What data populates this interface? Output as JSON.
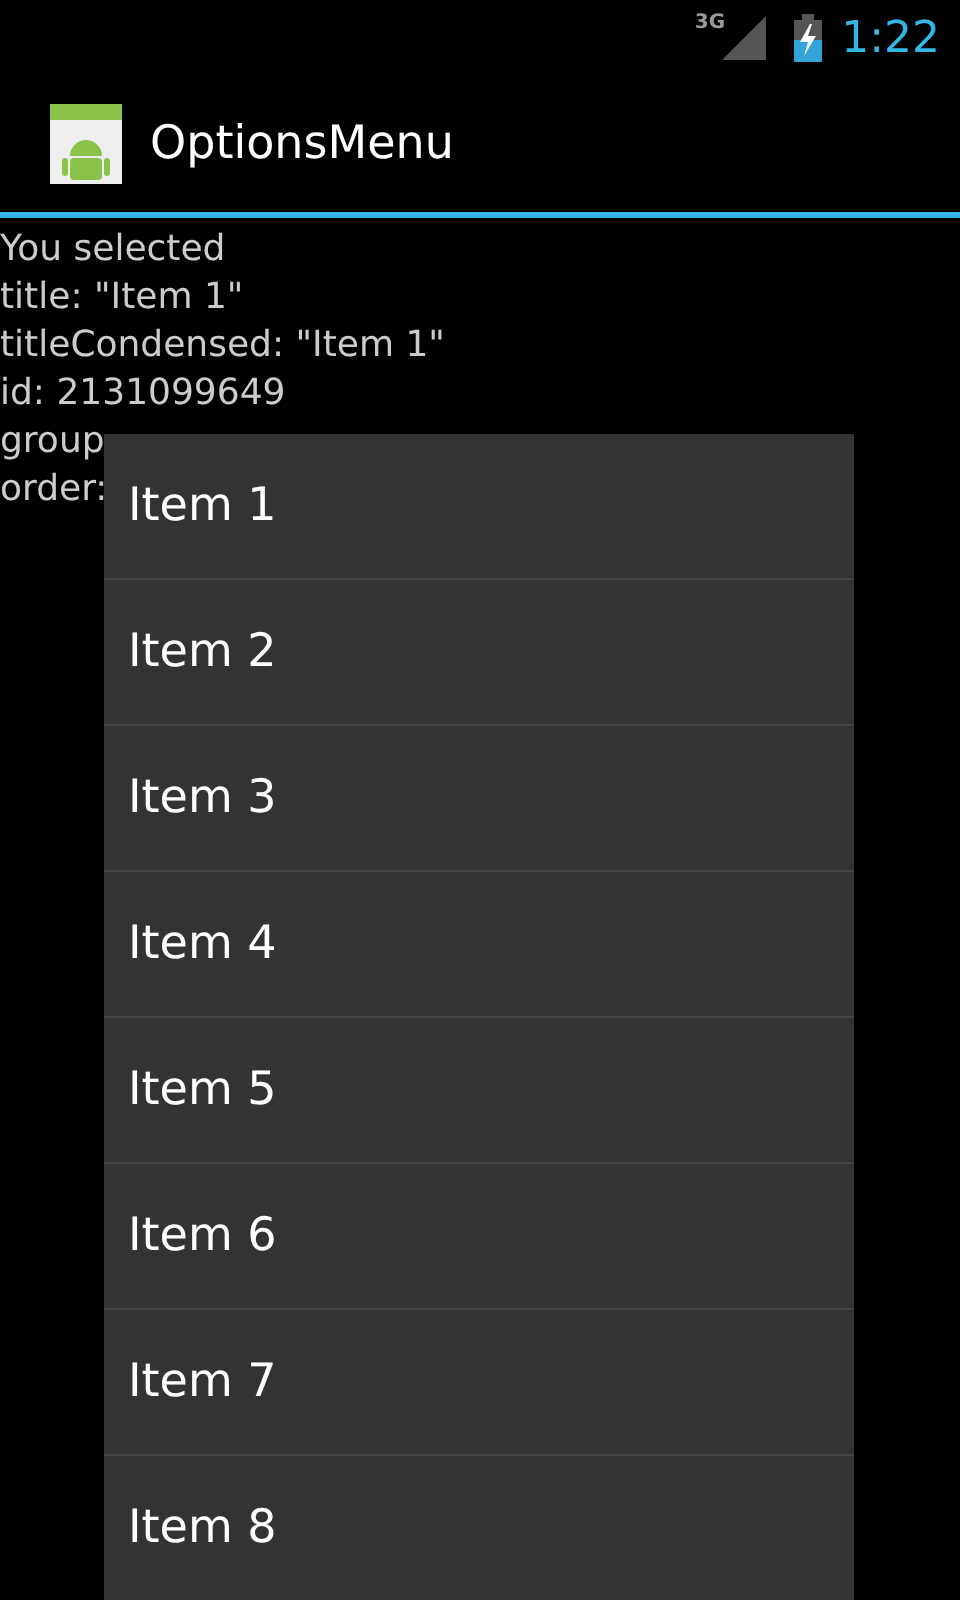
{
  "status_bar": {
    "network": "3G",
    "time": "1:22"
  },
  "action_bar": {
    "title": "OptionsMenu"
  },
  "content": {
    "lines": [
      "You selected",
      "title: \"Item 1\"",
      "titleCondensed: \"Item 1\"",
      "id: 2131099649",
      "group",
      "order:"
    ]
  },
  "menu": {
    "items": [
      "Item 1",
      "Item 2",
      "Item 3",
      "Item 4",
      "Item 5",
      "Item 6",
      "Item 7",
      "Item 8"
    ]
  }
}
